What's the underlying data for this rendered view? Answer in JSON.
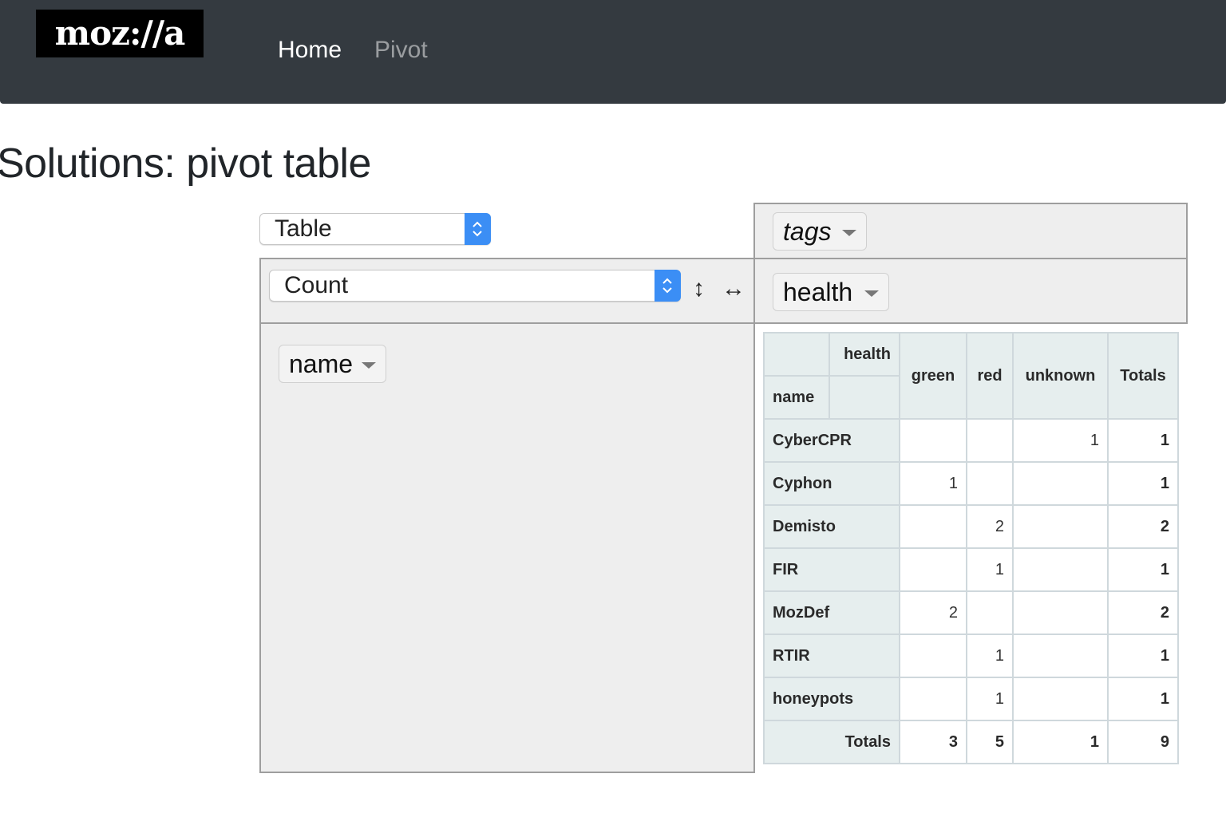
{
  "navbar": {
    "logo_text": "moz://a",
    "links": [
      {
        "label": "Home"
      },
      {
        "label": "Pivot"
      }
    ]
  },
  "page": {
    "title": "Solutions: pivot table"
  },
  "pivot": {
    "renderer": "Table",
    "aggregator": "Count",
    "sort_rows_icon": "↕",
    "sort_cols_icon": "↔",
    "unused_attrs": [
      "tags"
    ],
    "col_attrs": [
      "health"
    ],
    "row_attrs": [
      "name"
    ],
    "table": {
      "col_axis_label": "health",
      "row_axis_label": "name",
      "columns": [
        "green",
        "red",
        "unknown"
      ],
      "totals_label": "Totals",
      "rows": [
        {
          "name": "CyberCPR",
          "values": [
            "",
            "",
            "1"
          ],
          "total": "1"
        },
        {
          "name": "Cyphon",
          "values": [
            "1",
            "",
            ""
          ],
          "total": "1"
        },
        {
          "name": "Demisto",
          "values": [
            "",
            "2",
            ""
          ],
          "total": "2"
        },
        {
          "name": "FIR",
          "values": [
            "",
            "1",
            ""
          ],
          "total": "1"
        },
        {
          "name": "MozDef",
          "values": [
            "2",
            "",
            ""
          ],
          "total": "2"
        },
        {
          "name": "RTIR",
          "values": [
            "",
            "1",
            ""
          ],
          "total": "1"
        },
        {
          "name": "honeypots",
          "values": [
            "",
            "1",
            ""
          ],
          "total": "1"
        }
      ],
      "column_totals": [
        "3",
        "5",
        "1"
      ],
      "grand_total": "9"
    }
  },
  "colors": {
    "navbar_bg": "#343a40",
    "select_accent": "#3b8ef5",
    "table_header_bg": "#e6eeee",
    "pivot_area_bg": "#eeeeee"
  }
}
